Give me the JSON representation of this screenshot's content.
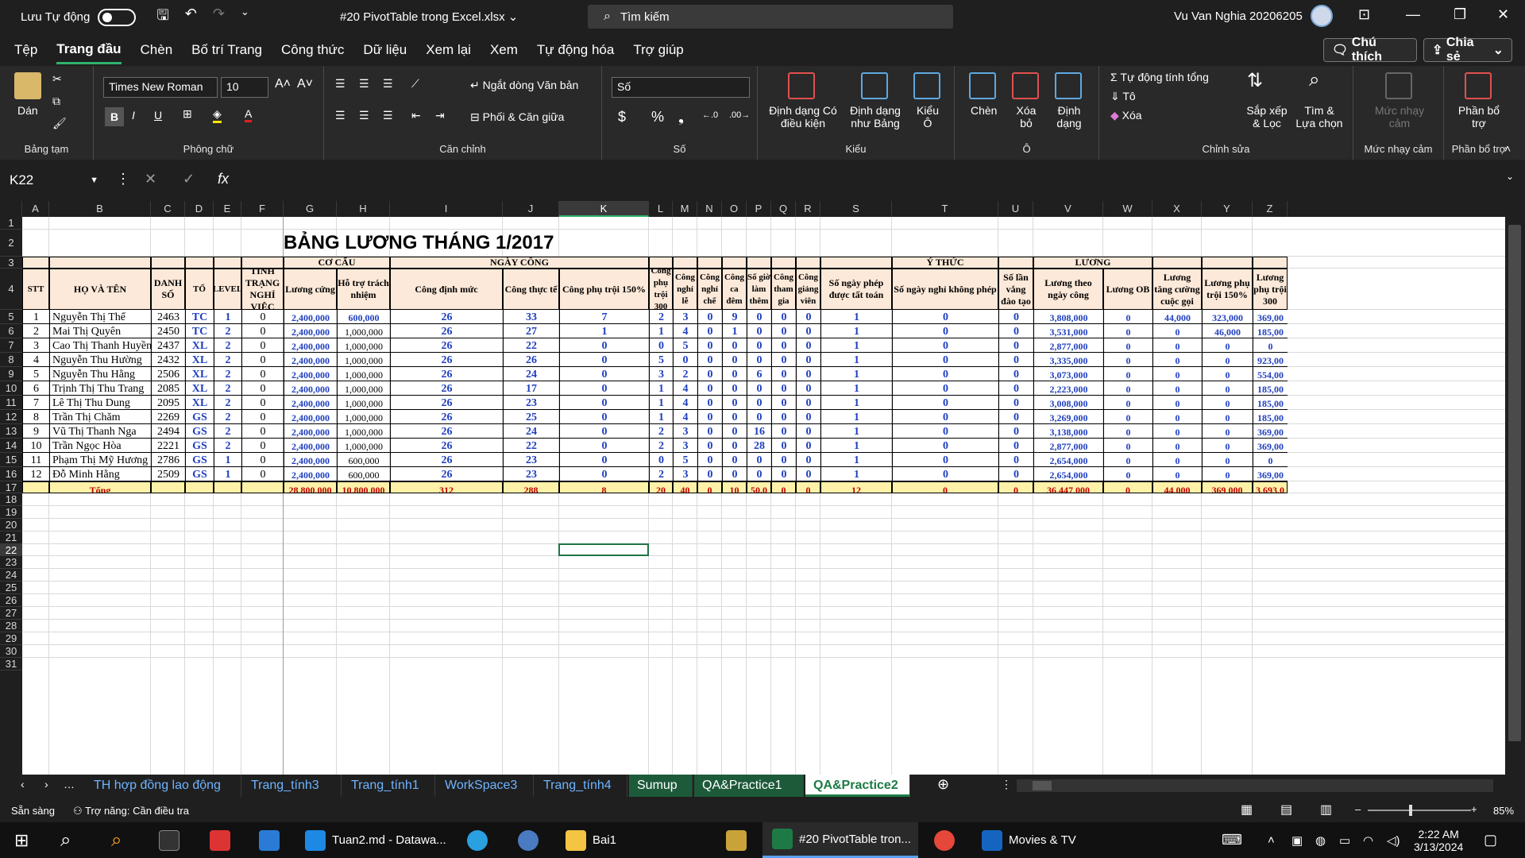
{
  "titlebar": {
    "autosave": "Lưu Tự động",
    "filename": "#20 PivotTable trong Excel.xlsx ⌄",
    "search": "Tìm kiếm",
    "user": "Vu Van Nghia 20206205"
  },
  "menu": [
    "Tệp",
    "Trang đầu",
    "Chèn",
    "Bố trí Trang",
    "Công thức",
    "Dữ liệu",
    "Xem lại",
    "Xem",
    "Tự động hóa",
    "Trợ giúp"
  ],
  "actions": {
    "comment": "Chú thích",
    "share": "Chia sẻ"
  },
  "ribbon": {
    "clipboard": {
      "paste": "Dán",
      "label": "Bảng tạm"
    },
    "font": {
      "name": "Times New Roman",
      "size": "10",
      "label": "Phông chữ"
    },
    "align": {
      "wrap": "Ngắt dòng Văn bản",
      "merge": "Phối & Căn giữa",
      "label": "Căn chỉnh"
    },
    "number": {
      "format": "Số",
      "label": "Số"
    },
    "styles": {
      "cond": "Định dạng Có điều kiện",
      "table": "Định dạng như Bảng",
      "cell": "Kiểu Ô",
      "label": "Kiểu"
    },
    "cells": {
      "insert": "Chèn",
      "delete": "Xóa bỏ",
      "format": "Định dạng",
      "label": "Ô"
    },
    "editing": {
      "autosum": "Tự động tính tổng",
      "fill": "Tô",
      "clear": "Xóa",
      "sort": "Sắp xếp & Lọc",
      "find": "Tìm & Lựa chọn",
      "label": "Chỉnh sửa"
    },
    "sens": {
      "btn": "Mức nhạy cảm",
      "label": "Mức nhạy cảm"
    },
    "addin": {
      "btn": "Phần bổ trợ",
      "label": "Phần bổ trợ"
    }
  },
  "namebox": "K22",
  "columns": [
    "A",
    "B",
    "C",
    "D",
    "E",
    "F",
    "G",
    "H",
    "I",
    "J",
    "K",
    "L",
    "M",
    "N",
    "O",
    "P",
    "Q",
    "R",
    "S",
    "T",
    "U",
    "V",
    "W",
    "X",
    "Y",
    "Z"
  ],
  "sheet": {
    "title": "BẢNG LƯƠNG THÁNG 1/2017",
    "groups": {
      "cocau": "CƠ CẤU",
      "ngaycong": "NGÀY CÔNG",
      "ythuc": "Ý THỨC",
      "luong": "LƯƠNG"
    },
    "headers": [
      "STT",
      "HỌ VÀ TÊN",
      "DANH SỐ",
      "TỔ",
      "LEVEL",
      "TÌNH TRẠNG NGHỈ VIỆC",
      "Lương cứng",
      "Hỗ trợ trách nhiệm",
      "Công định mức",
      "Công thực tế",
      "Công phụ trội 150%",
      "Công phụ trội 300",
      "Công nghỉ lễ",
      "Công nghỉ chế",
      "Công ca đêm",
      "Số giờ làm thêm",
      "Công tham gia",
      "Công giảng viên",
      "Số ngày phép được tất toán",
      "Số ngày nghỉ không phép",
      "Số lần vắng đào tạo",
      "Lương theo ngày công",
      "Lương OB",
      "Lương tăng cường cuộc gọi",
      "Lương phụ trội 150%",
      "Lương phụ trội 300"
    ],
    "rows": [
      [
        "1",
        "Nguyễn Thị Thể",
        "2463",
        "TC",
        "1",
        "0",
        "2,400,000",
        "600,000",
        "26",
        "33",
        "7",
        "2",
        "3",
        "0",
        "9",
        "0",
        "0",
        "0",
        "1",
        "0",
        "0",
        "3,808,000",
        "0",
        "44,000",
        "323,000",
        "369,00"
      ],
      [
        "2",
        "Mai Thị Quyên",
        "2450",
        "TC",
        "2",
        "0",
        "2,400,000",
        "1,000,000",
        "26",
        "27",
        "1",
        "1",
        "4",
        "0",
        "1",
        "0",
        "0",
        "0",
        "1",
        "0",
        "0",
        "3,531,000",
        "0",
        "0",
        "46,000",
        "185,00"
      ],
      [
        "3",
        "Cao Thị Thanh Huyền",
        "2437",
        "XL",
        "2",
        "0",
        "2,400,000",
        "1,000,000",
        "26",
        "22",
        "0",
        "0",
        "5",
        "0",
        "0",
        "0",
        "0",
        "0",
        "1",
        "0",
        "0",
        "2,877,000",
        "0",
        "0",
        "0",
        "0"
      ],
      [
        "4",
        "Nguyễn Thu Hường",
        "2432",
        "XL",
        "2",
        "0",
        "2,400,000",
        "1,000,000",
        "26",
        "26",
        "0",
        "5",
        "0",
        "0",
        "0",
        "0",
        "0",
        "0",
        "1",
        "0",
        "0",
        "3,335,000",
        "0",
        "0",
        "0",
        "923,00"
      ],
      [
        "5",
        "Nguyễn Thu Hằng",
        "2506",
        "XL",
        "2",
        "0",
        "2,400,000",
        "1,000,000",
        "26",
        "24",
        "0",
        "3",
        "2",
        "0",
        "0",
        "6",
        "0",
        "0",
        "1",
        "0",
        "0",
        "3,073,000",
        "0",
        "0",
        "0",
        "554,00"
      ],
      [
        "6",
        "Trịnh Thị Thu Trang",
        "2085",
        "XL",
        "2",
        "0",
        "2,400,000",
        "1,000,000",
        "26",
        "17",
        "0",
        "1",
        "4",
        "0",
        "0",
        "0",
        "0",
        "0",
        "1",
        "0",
        "0",
        "2,223,000",
        "0",
        "0",
        "0",
        "185,00"
      ],
      [
        "7",
        "Lê Thị Thu Dung",
        "2095",
        "XL",
        "2",
        "0",
        "2,400,000",
        "1,000,000",
        "26",
        "23",
        "0",
        "1",
        "4",
        "0",
        "0",
        "0",
        "0",
        "0",
        "1",
        "0",
        "0",
        "3,008,000",
        "0",
        "0",
        "0",
        "185,00"
      ],
      [
        "8",
        "Trần Thị Chăm",
        "2269",
        "GS",
        "2",
        "0",
        "2,400,000",
        "1,000,000",
        "26",
        "25",
        "0",
        "1",
        "4",
        "0",
        "0",
        "0",
        "0",
        "0",
        "1",
        "0",
        "0",
        "3,269,000",
        "0",
        "0",
        "0",
        "185,00"
      ],
      [
        "9",
        "Vũ Thị Thanh Nga",
        "2494",
        "GS",
        "2",
        "0",
        "2,400,000",
        "1,000,000",
        "26",
        "24",
        "0",
        "2",
        "3",
        "0",
        "0",
        "16",
        "0",
        "0",
        "1",
        "0",
        "0",
        "3,138,000",
        "0",
        "0",
        "0",
        "369,00"
      ],
      [
        "10",
        "Trần Ngọc Hòa",
        "2221",
        "GS",
        "2",
        "0",
        "2,400,000",
        "1,000,000",
        "26",
        "22",
        "0",
        "2",
        "3",
        "0",
        "0",
        "28",
        "0",
        "0",
        "1",
        "0",
        "0",
        "2,877,000",
        "0",
        "0",
        "0",
        "369,00"
      ],
      [
        "11",
        "Phạm Thị Mỹ Hương",
        "2786",
        "GS",
        "1",
        "0",
        "2,400,000",
        "600,000",
        "26",
        "23",
        "0",
        "0",
        "5",
        "0",
        "0",
        "0",
        "0",
        "0",
        "1",
        "0",
        "0",
        "2,654,000",
        "0",
        "0",
        "0",
        "0"
      ],
      [
        "12",
        "Đỗ Minh Hằng",
        "2509",
        "GS",
        "1",
        "0",
        "2,400,000",
        "600,000",
        "26",
        "23",
        "0",
        "2",
        "3",
        "0",
        "0",
        "0",
        "0",
        "0",
        "1",
        "0",
        "0",
        "2,654,000",
        "0",
        "0",
        "0",
        "369,00"
      ]
    ],
    "total": [
      "Tổng",
      "",
      "",
      "",
      "",
      "28,800,000",
      "10,800,000",
      "312",
      "288",
      "8",
      "20",
      "40",
      "0",
      "10",
      "50.0",
      "0",
      "0",
      "12",
      "0",
      "0",
      "36,447,000",
      "0",
      "44,000",
      "369,000",
      "3,693,0"
    ]
  },
  "tabs": [
    "TH hợp đồng lao động",
    "Trang_tính3",
    "Trang_tính1",
    "WorkSpace3",
    "Trang_tính4",
    "Sumup",
    "QA&Practice1",
    "QA&Practice2"
  ],
  "status": {
    "ready": "Sẵn sàng",
    "access": "Trợ năng: Cần điều tra",
    "zoom": "85%"
  },
  "taskbar": {
    "vscode": "Tuan2.md - Datawa...",
    "files": "Bai1",
    "excel": "#20 PivotTable tron...",
    "movies": "Movies & TV",
    "time": "2:22 AM",
    "date": "3/13/2024"
  }
}
